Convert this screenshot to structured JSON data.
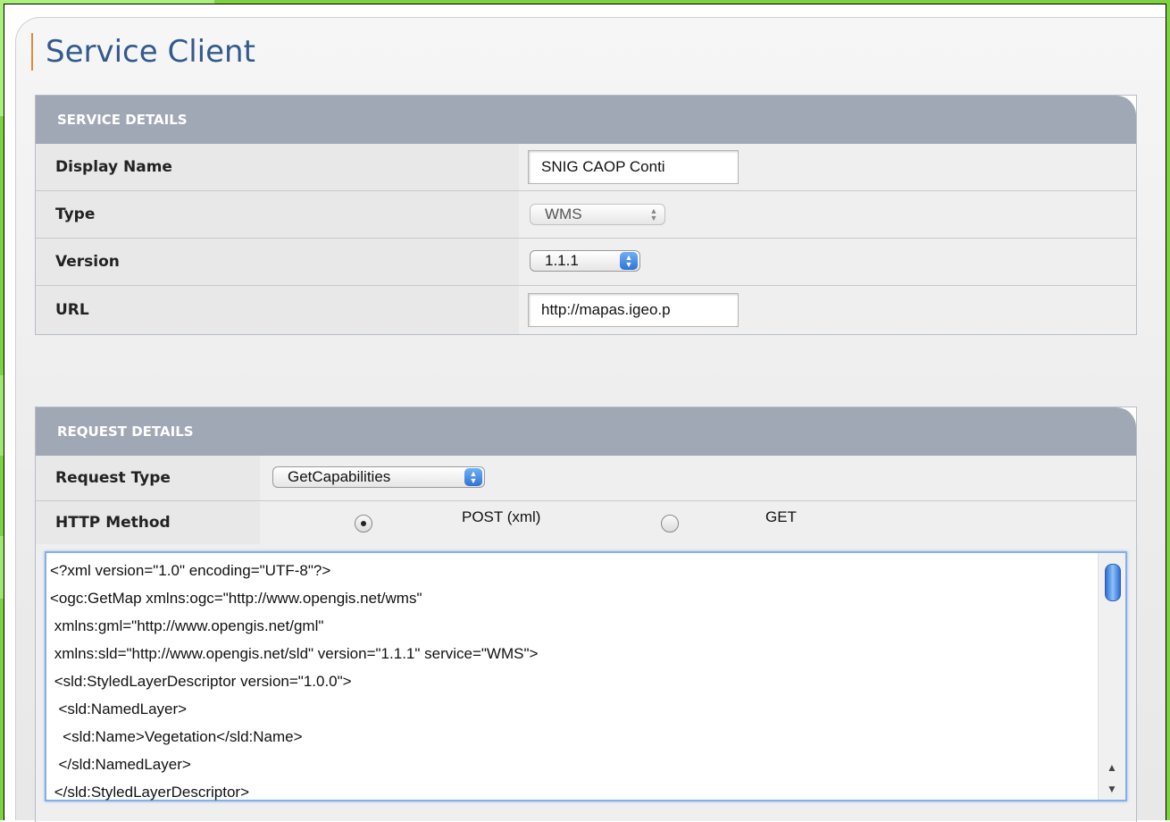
{
  "page": {
    "title": "Service Client"
  },
  "service_details": {
    "header": "SERVICE DETAILS",
    "display_name_label": "Display Name",
    "display_name_value": "SNIG CAOP Conti",
    "type_label": "Type",
    "type_value": "WMS",
    "version_label": "Version",
    "version_value": "1.1.1",
    "url_label": "URL",
    "url_value": "http://mapas.igeo.p"
  },
  "request_details": {
    "header": "REQUEST DETAILS",
    "request_type_label": "Request Type",
    "request_type_value": "GetCapabilities",
    "http_method_label": "HTTP Method",
    "method_post_label": "POST (xml)",
    "method_get_label": "GET",
    "selected_method": "POST (xml)",
    "xml_lines": [
      "<?xml version=\"1.0\" encoding=\"UTF-8\"?>",
      "<ogc:GetMap xmlns:ogc=\"http://www.opengis.net/wms\"",
      " xmlns:gml=\"http://www.opengis.net/gml\"",
      " xmlns:sld=\"http://www.opengis.net/sld\" version=\"1.1.1\" service=\"WMS\">",
      " <sld:StyledLayerDescriptor version=\"1.0.0\">",
      "  <sld:NamedLayer>",
      "   <sld:Name>Vegetation</sld:Name>",
      "  </sld:NamedLayer>",
      " </sld:StyledLayerDescriptor>"
    ]
  },
  "colors": {
    "accent_title": "#335a8c",
    "section_header": "#a1a8b5",
    "title_bar_accent": "#e38a3a",
    "background_green": "#7cd33f"
  }
}
